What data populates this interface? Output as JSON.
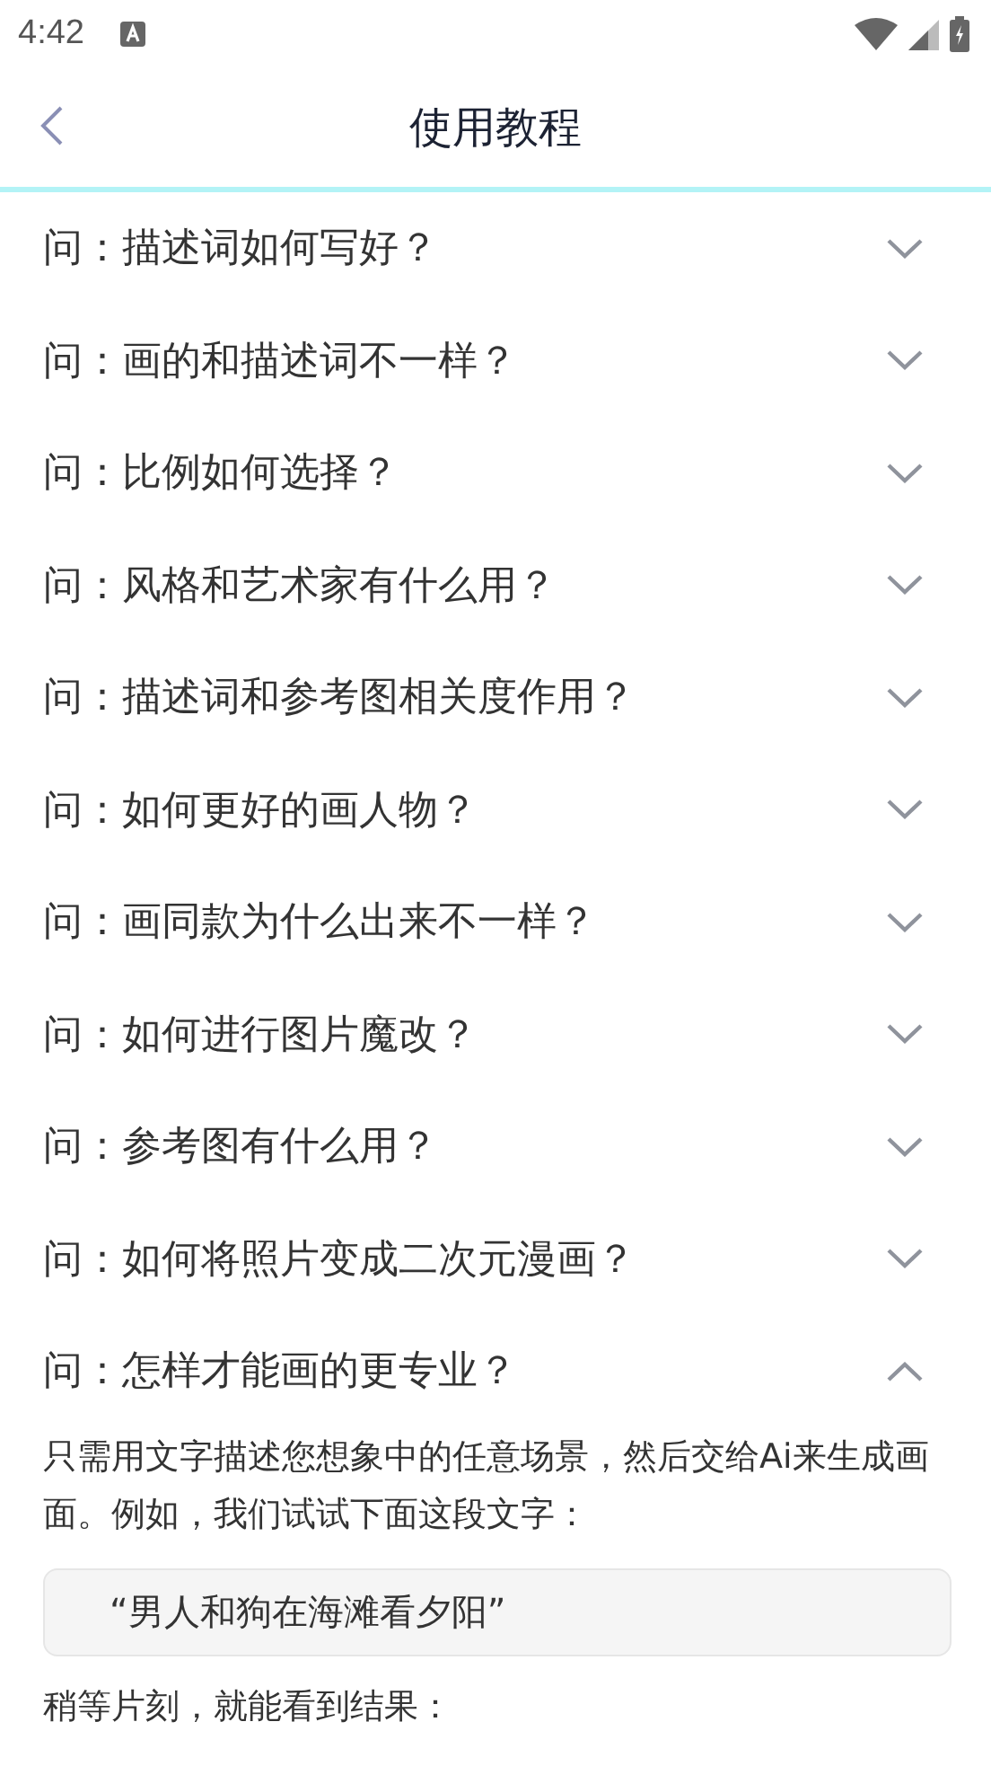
{
  "status_bar": {
    "time": "4:42"
  },
  "header": {
    "title": "使用教程"
  },
  "faq": [
    {
      "question": "问：描述词如何写好？",
      "expanded": false
    },
    {
      "question": "问：画的和描述词不一样？",
      "expanded": false
    },
    {
      "question": "问：比例如何选择？",
      "expanded": false
    },
    {
      "question": "问：风格和艺术家有什么用？",
      "expanded": false
    },
    {
      "question": "问：描述词和参考图相关度作用？",
      "expanded": false
    },
    {
      "question": "问：如何更好的画人物？",
      "expanded": false
    },
    {
      "question": "问：画同款为什么出来不一样？",
      "expanded": false
    },
    {
      "question": "问：如何进行图片魔改？",
      "expanded": false
    },
    {
      "question": "问：参考图有什么用？",
      "expanded": false
    },
    {
      "question": "问：如何将照片变成二次元漫画？",
      "expanded": false
    },
    {
      "question": "问：怎样才能画的更专业？",
      "expanded": true,
      "answer": [
        {
          "kind": "text",
          "text": "只需用文字描述您想象中的任意场景，然后交给Ai来生成画面。例如，我们试试下面这段文字："
        },
        {
          "kind": "quote",
          "text": "“男人和狗在海滩看夕阳”"
        },
        {
          "kind": "text",
          "text": "稍等片刻，就能看到结果："
        }
      ]
    }
  ]
}
